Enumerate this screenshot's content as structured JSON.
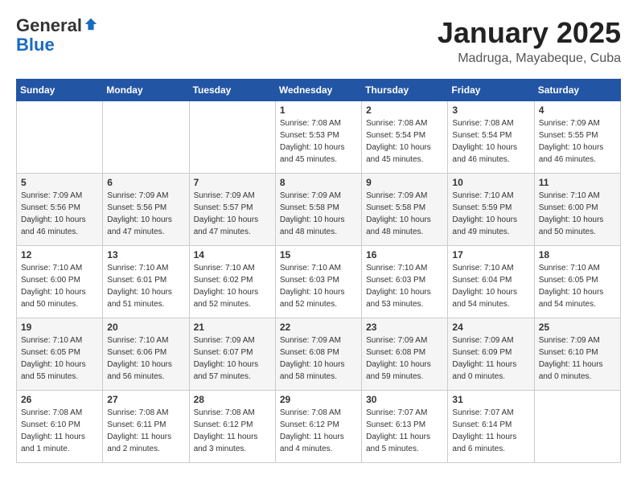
{
  "header": {
    "logo_line1": "General",
    "logo_line2": "Blue",
    "title": "January 2025",
    "location": "Madruga, Mayabeque, Cuba"
  },
  "days_of_week": [
    "Sunday",
    "Monday",
    "Tuesday",
    "Wednesday",
    "Thursday",
    "Friday",
    "Saturday"
  ],
  "weeks": [
    [
      {
        "day": "",
        "info": ""
      },
      {
        "day": "",
        "info": ""
      },
      {
        "day": "",
        "info": ""
      },
      {
        "day": "1",
        "info": "Sunrise: 7:08 AM\nSunset: 5:53 PM\nDaylight: 10 hours and 45 minutes."
      },
      {
        "day": "2",
        "info": "Sunrise: 7:08 AM\nSunset: 5:54 PM\nDaylight: 10 hours and 45 minutes."
      },
      {
        "day": "3",
        "info": "Sunrise: 7:08 AM\nSunset: 5:54 PM\nDaylight: 10 hours and 46 minutes."
      },
      {
        "day": "4",
        "info": "Sunrise: 7:09 AM\nSunset: 5:55 PM\nDaylight: 10 hours and 46 minutes."
      }
    ],
    [
      {
        "day": "5",
        "info": "Sunrise: 7:09 AM\nSunset: 5:56 PM\nDaylight: 10 hours and 46 minutes."
      },
      {
        "day": "6",
        "info": "Sunrise: 7:09 AM\nSunset: 5:56 PM\nDaylight: 10 hours and 47 minutes."
      },
      {
        "day": "7",
        "info": "Sunrise: 7:09 AM\nSunset: 5:57 PM\nDaylight: 10 hours and 47 minutes."
      },
      {
        "day": "8",
        "info": "Sunrise: 7:09 AM\nSunset: 5:58 PM\nDaylight: 10 hours and 48 minutes."
      },
      {
        "day": "9",
        "info": "Sunrise: 7:09 AM\nSunset: 5:58 PM\nDaylight: 10 hours and 48 minutes."
      },
      {
        "day": "10",
        "info": "Sunrise: 7:10 AM\nSunset: 5:59 PM\nDaylight: 10 hours and 49 minutes."
      },
      {
        "day": "11",
        "info": "Sunrise: 7:10 AM\nSunset: 6:00 PM\nDaylight: 10 hours and 50 minutes."
      }
    ],
    [
      {
        "day": "12",
        "info": "Sunrise: 7:10 AM\nSunset: 6:00 PM\nDaylight: 10 hours and 50 minutes."
      },
      {
        "day": "13",
        "info": "Sunrise: 7:10 AM\nSunset: 6:01 PM\nDaylight: 10 hours and 51 minutes."
      },
      {
        "day": "14",
        "info": "Sunrise: 7:10 AM\nSunset: 6:02 PM\nDaylight: 10 hours and 52 minutes."
      },
      {
        "day": "15",
        "info": "Sunrise: 7:10 AM\nSunset: 6:03 PM\nDaylight: 10 hours and 52 minutes."
      },
      {
        "day": "16",
        "info": "Sunrise: 7:10 AM\nSunset: 6:03 PM\nDaylight: 10 hours and 53 minutes."
      },
      {
        "day": "17",
        "info": "Sunrise: 7:10 AM\nSunset: 6:04 PM\nDaylight: 10 hours and 54 minutes."
      },
      {
        "day": "18",
        "info": "Sunrise: 7:10 AM\nSunset: 6:05 PM\nDaylight: 10 hours and 54 minutes."
      }
    ],
    [
      {
        "day": "19",
        "info": "Sunrise: 7:10 AM\nSunset: 6:05 PM\nDaylight: 10 hours and 55 minutes."
      },
      {
        "day": "20",
        "info": "Sunrise: 7:10 AM\nSunset: 6:06 PM\nDaylight: 10 hours and 56 minutes."
      },
      {
        "day": "21",
        "info": "Sunrise: 7:09 AM\nSunset: 6:07 PM\nDaylight: 10 hours and 57 minutes."
      },
      {
        "day": "22",
        "info": "Sunrise: 7:09 AM\nSunset: 6:08 PM\nDaylight: 10 hours and 58 minutes."
      },
      {
        "day": "23",
        "info": "Sunrise: 7:09 AM\nSunset: 6:08 PM\nDaylight: 10 hours and 59 minutes."
      },
      {
        "day": "24",
        "info": "Sunrise: 7:09 AM\nSunset: 6:09 PM\nDaylight: 11 hours and 0 minutes."
      },
      {
        "day": "25",
        "info": "Sunrise: 7:09 AM\nSunset: 6:10 PM\nDaylight: 11 hours and 0 minutes."
      }
    ],
    [
      {
        "day": "26",
        "info": "Sunrise: 7:08 AM\nSunset: 6:10 PM\nDaylight: 11 hours and 1 minute."
      },
      {
        "day": "27",
        "info": "Sunrise: 7:08 AM\nSunset: 6:11 PM\nDaylight: 11 hours and 2 minutes."
      },
      {
        "day": "28",
        "info": "Sunrise: 7:08 AM\nSunset: 6:12 PM\nDaylight: 11 hours and 3 minutes."
      },
      {
        "day": "29",
        "info": "Sunrise: 7:08 AM\nSunset: 6:12 PM\nDaylight: 11 hours and 4 minutes."
      },
      {
        "day": "30",
        "info": "Sunrise: 7:07 AM\nSunset: 6:13 PM\nDaylight: 11 hours and 5 minutes."
      },
      {
        "day": "31",
        "info": "Sunrise: 7:07 AM\nSunset: 6:14 PM\nDaylight: 11 hours and 6 minutes."
      },
      {
        "day": "",
        "info": ""
      }
    ]
  ]
}
